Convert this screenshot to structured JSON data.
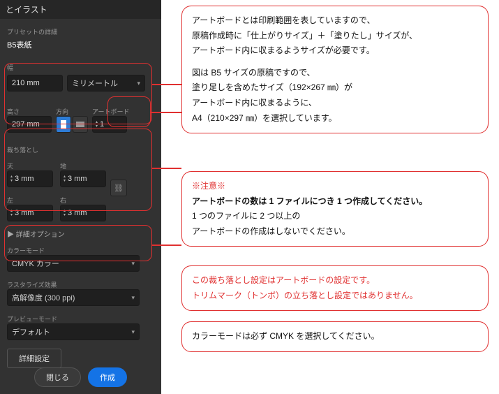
{
  "panel": {
    "title": "とイラスト",
    "preset_label": "プリセットの詳細",
    "preset_name": "B5表紙",
    "width_label": "幅",
    "width_value": "210 mm",
    "unit_selected": "ミリメートル",
    "height_label": "高さ",
    "height_value": "297 mm",
    "orient_label": "方向",
    "artboard_label": "アートボード",
    "artboard_count": "1",
    "bleed_label": "裁ち落とし",
    "bleed_top_label": "天",
    "bleed_bottom_label": "地",
    "bleed_left_label": "左",
    "bleed_right_label": "右",
    "bleed_value": "3 mm",
    "adv_toggle": "▶ 詳細オプション",
    "colormode_label": "カラーモード",
    "colormode_value": "CMYK カラー",
    "raster_label": "ラスタライズ効果",
    "raster_value": "高解像度 (300 ppi)",
    "preview_label": "プレビューモード",
    "preview_value": "デフォルト",
    "more_btn": "詳細設定",
    "close_btn": "閉じる",
    "create_btn": "作成"
  },
  "callouts": {
    "c1_l1": "アートボードとは印刷範囲を表していますので、",
    "c1_l2": "原稿作成時に「仕上がりサイズ」＋「塗りたし」サイズが、",
    "c1_l3": "アートボード内に収まるようサイズが必要です。",
    "c1_l4": "図は B5 サイズの原稿ですので、",
    "c1_l5": "塗り足しを含めたサイズ（192×267 ㎜）が",
    "c1_l6": "アートボード内に収まるように、",
    "c1_l7": "A4（210×297 ㎜）を選択しています。",
    "c2_l1": "※注意※",
    "c2_l2": "アートボードの数は 1 ファイルにつき 1 つ作成してください。",
    "c2_l3": "1 つのファイルに 2 つ以上の",
    "c2_l4": "アートボードの作成はしないでください。",
    "c3_l1": "この裁ち落とし設定はアートボードの設定です。",
    "c3_l2": "トリムマーク（トンボ）の立ち落とし設定ではありません。",
    "c4_l1": "カラーモードは必ず CMYK を選択してください。"
  }
}
